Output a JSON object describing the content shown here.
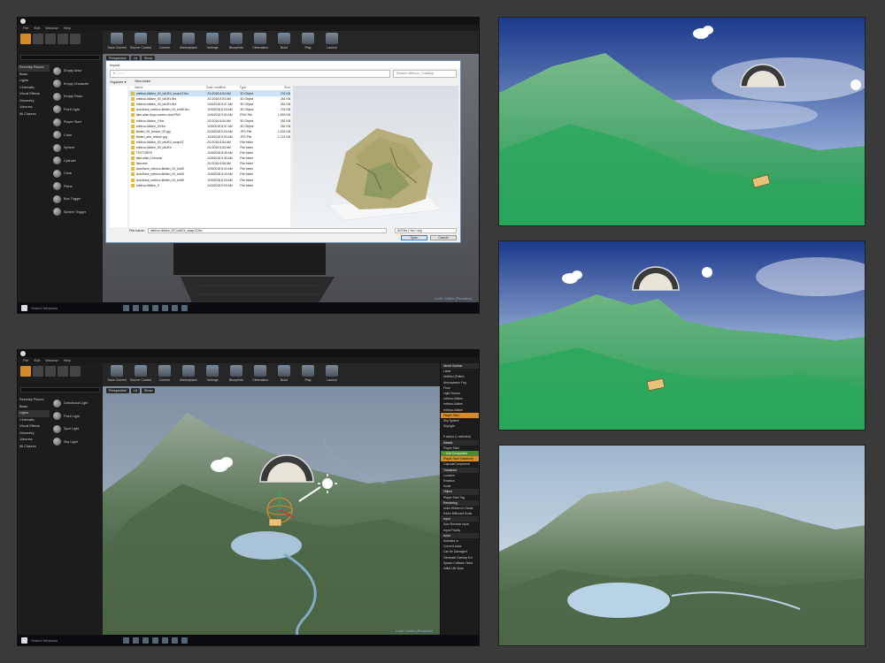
{
  "editor_top": {
    "menu": [
      "File",
      "Edit",
      "Window",
      "Help"
    ],
    "toolbar": [
      "Save Current",
      "Source Control",
      "Content",
      "Marketplace",
      "Settings",
      "Blueprints",
      "Cinematics",
      "Build",
      "Play",
      "Launch"
    ],
    "categories": [
      "Recently Placed",
      "Basic",
      "Lights",
      "Cinematic",
      "Visual Effects",
      "Geometry",
      "Volumes",
      "All Classes"
    ],
    "items": [
      "Empty Actor",
      "Empty Character",
      "Empty Pawn",
      "Point Light",
      "Player Start",
      "Cube",
      "Sphere",
      "Cylinder",
      "Cone",
      "Plane",
      "Box Trigger",
      "Sphere Trigger"
    ],
    "viewport_tabs": [
      "Perspective",
      "Lit",
      "Show"
    ],
    "status": "Level: Untitled (Persistent)",
    "taskbar_search": "Search Windows"
  },
  "dialog": {
    "title": "Import",
    "path": "« ... › ...",
    "search_placeholder": "Search Mthhoo_CudlApp",
    "organize": "Organize ▾",
    "new_folder": "New folder",
    "columns": [
      "Name",
      "Date modified",
      "Type",
      "Size"
    ],
    "files": [
      {
        "name": "mthhoo-lkilden_00_txtUE4_swap1Z.fbx",
        "date": "2/1/2018 8:54 AM",
        "type": "3D Object",
        "size": "232 KB"
      },
      {
        "name": "mthhoo-lkilden_00_txtUE4.fbx",
        "date": "2/1/2018 8:53 AM",
        "type": "3D Object",
        "size": "281 KB"
      },
      {
        "name": "mthhoo-lkilden_00_txtUE4.fbx",
        "date": "1/26/2018 8:37 AM",
        "type": "3D Object",
        "size": "281 KB"
      },
      {
        "name": "AutoSave_mthhoo-lkilden_00_txtUE.fbx",
        "date": "1/26/2018 8:43 AM",
        "type": "3D Object",
        "size": "232 KB"
      },
      {
        "name": "lake-ailan-5yqu-screen-shot.PNG",
        "date": "1/26/2018 9:53 AM",
        "type": "PNG File",
        "size": "1,593 KB"
      },
      {
        "name": "mthhoo-lkilden_0.fbx",
        "date": "2/1/2018 8:54 AM",
        "type": "3D Object",
        "size": "281 KB"
      },
      {
        "name": "mthhoo-lkilden_00.fbx",
        "date": "1/26/2018 8:37 AM",
        "type": "3D Object",
        "size": "281 KB"
      },
      {
        "name": "lkilden_00_texture_00.jpg",
        "date": "1/18/2018 9:03 AM",
        "type": "JPG File",
        "size": "1,632 KB"
      },
      {
        "name": "lkilden_and_texture.jpg",
        "date": "1/18/2018 9:03 AM",
        "type": "JPG File",
        "size": "1,222 KB"
      },
      {
        "name": "mthhoo-lkilden_00_txtUE4_swap1Z",
        "date": "2/1/2018 8:54 AM",
        "type": "File folder",
        "size": ""
      },
      {
        "name": "mthhoo-lkilden_00_txtUE4",
        "date": "2/1/2018 8:53 AM",
        "type": "File folder",
        "size": ""
      },
      {
        "name": "TEXTURES",
        "date": "1/26/2018 8:39 AM",
        "type": "File folder",
        "size": ""
      },
      {
        "name": "lake-ailan-2 browse",
        "date": "1/26/2018 9:40 AM",
        "type": "File folder",
        "size": ""
      },
      {
        "name": "fishcrest",
        "date": "2/1/2018 8:58 AM",
        "type": "File folder",
        "size": ""
      },
      {
        "name": "AutoSave_mthhoo-lkilden_00_txtUE",
        "date": "1/26/2018 8:43 AM",
        "type": "File folder",
        "size": ""
      },
      {
        "name": "AutoSave_mthhoo-lkilden_00_txtUE",
        "date": "1/26/2018 8:43 AM",
        "type": "File folder",
        "size": ""
      },
      {
        "name": "AutoSave_mthhoo-lkilden_00_txtUE",
        "date": "1/26/2018 8:43 AM",
        "type": "File folder",
        "size": ""
      },
      {
        "name": "mthhoo-lkilden_0",
        "date": "1/18/2018 9:00 AM",
        "type": "File folder",
        "size": ""
      }
    ],
    "file_name_label": "File name:",
    "file_name_value": "mthhoo-lkilden_00_txtUE4_swap1Z.fbx",
    "file_type": "All Files (*.fbx;*.obj)",
    "open": "Open",
    "cancel": "Cancel"
  },
  "editor_bottom": {
    "menu": [
      "File",
      "Edit",
      "Window",
      "Help"
    ],
    "categories": [
      "Recently Placed",
      "Basic",
      "Lights",
      "Cinematic",
      "Visual Effects",
      "Geometry",
      "Volumes",
      "All Classes"
    ],
    "items": [
      "Directional Light",
      "Point Light",
      "Spot Light",
      "Sky Light"
    ],
    "viewport_tabs": [
      "Perspective",
      "Lit",
      "Show"
    ],
    "details_rows": [
      {
        "t": "World Outliner",
        "c": "sec"
      },
      {
        "t": "Label",
        "c": ""
      },
      {
        "t": "Untitled (Editor)",
        "c": ""
      },
      {
        "t": "Atmospheric Fog",
        "c": ""
      },
      {
        "t": "Floor",
        "c": ""
      },
      {
        "t": "Light Source",
        "c": ""
      },
      {
        "t": "mthhoo-lkilden",
        "c": ""
      },
      {
        "t": "mthhoo-lkilden",
        "c": ""
      },
      {
        "t": "mthhoo-lkilden",
        "c": ""
      },
      {
        "t": "Player Start",
        "c": "hl"
      },
      {
        "t": "Sky Sphere",
        "c": ""
      },
      {
        "t": "SkyLight",
        "c": ""
      },
      {
        "t": "",
        "c": ""
      },
      {
        "t": "9 actors (1 selected)",
        "c": ""
      },
      {
        "t": "Details",
        "c": "sec"
      },
      {
        "t": "Player Start",
        "c": ""
      },
      {
        "t": "+ Add Component",
        "c": "add"
      },
      {
        "t": "Player Start (Instance)",
        "c": "hl"
      },
      {
        "t": "CapsuleComponent",
        "c": ""
      },
      {
        "t": "Transform",
        "c": "sec"
      },
      {
        "t": "Location",
        "c": ""
      },
      {
        "t": "Rotation",
        "c": ""
      },
      {
        "t": "Scale",
        "c": ""
      },
      {
        "t": "Object",
        "c": "sec"
      },
      {
        "t": "Player Start Tag",
        "c": ""
      },
      {
        "t": "Rendering",
        "c": "sec"
      },
      {
        "t": "Actor Hidden In Game",
        "c": ""
      },
      {
        "t": "Editor Billboard Scale",
        "c": ""
      },
      {
        "t": "Input",
        "c": "sec"
      },
      {
        "t": "Auto Receive Input",
        "c": ""
      },
      {
        "t": "Input Priority",
        "c": ""
      },
      {
        "t": "Actor",
        "c": "sec"
      },
      {
        "t": "Selected in",
        "c": ""
      },
      {
        "t": "Convert Actor",
        "c": ""
      },
      {
        "t": "Can be Damaged",
        "c": ""
      },
      {
        "t": "Generate Overlap Evt",
        "c": ""
      },
      {
        "t": "Spawn Collision Hand",
        "c": ""
      },
      {
        "t": "Initial Life Span",
        "c": ""
      }
    ],
    "status": "Level: Untitled (Persistent)",
    "taskbar_search": "Search Windows"
  },
  "colors": {
    "accent": "#d58b2a",
    "sky_top": "#1c3a8c",
    "green_terrain": "#2e9a55",
    "real_terrain": "#5d7a59"
  }
}
